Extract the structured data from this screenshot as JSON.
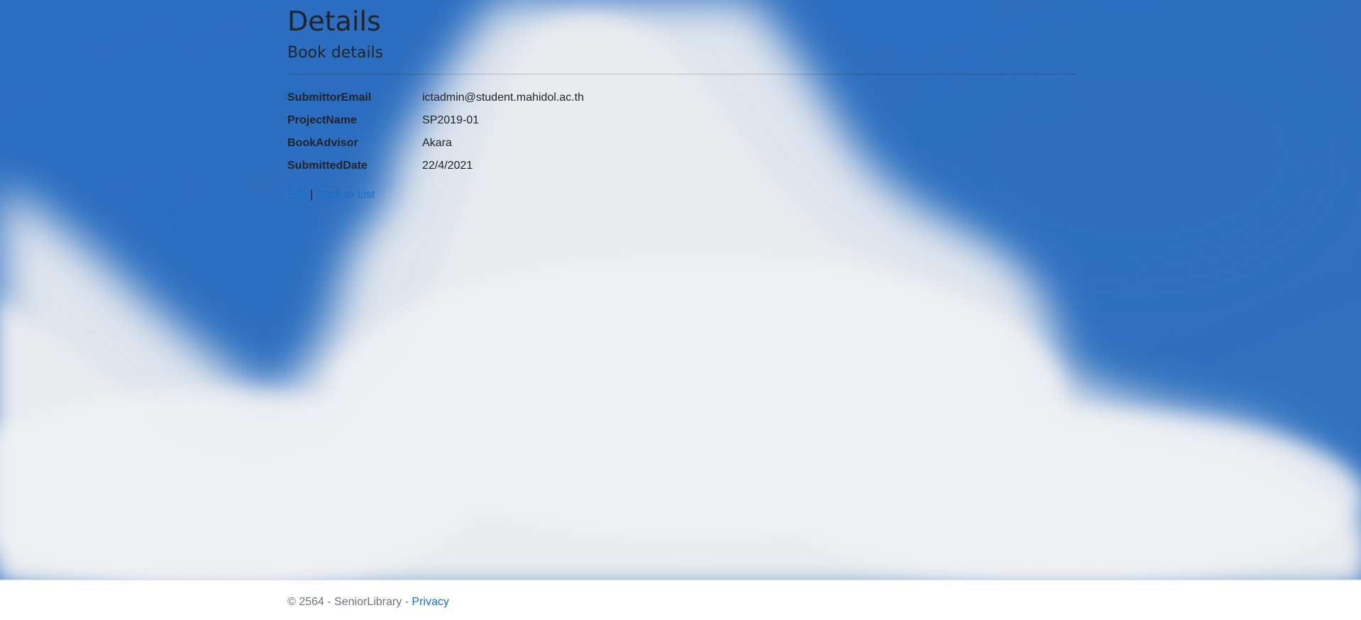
{
  "page": {
    "title": "Details",
    "subtitle": "Book details"
  },
  "details": {
    "items": [
      {
        "label": "SubmittorEmail",
        "value": "ictadmin@student.mahidol.ac.th"
      },
      {
        "label": "ProjectName",
        "value": "SP2019-01"
      },
      {
        "label": "BookAdvisor",
        "value": "Akara"
      },
      {
        "label": "SubmittedDate",
        "value": "22/4/2021"
      }
    ]
  },
  "actions": {
    "edit_label": "Edit",
    "separator": "|",
    "back_label": "Back to List"
  },
  "footer": {
    "copyright": "© 2564 - SeniorLibrary - ",
    "privacy_label": "Privacy"
  },
  "colors": {
    "sky": "#2e6fbd",
    "link": "#1b6ec2",
    "text": "#212529",
    "footer_text": "#6c757d"
  }
}
